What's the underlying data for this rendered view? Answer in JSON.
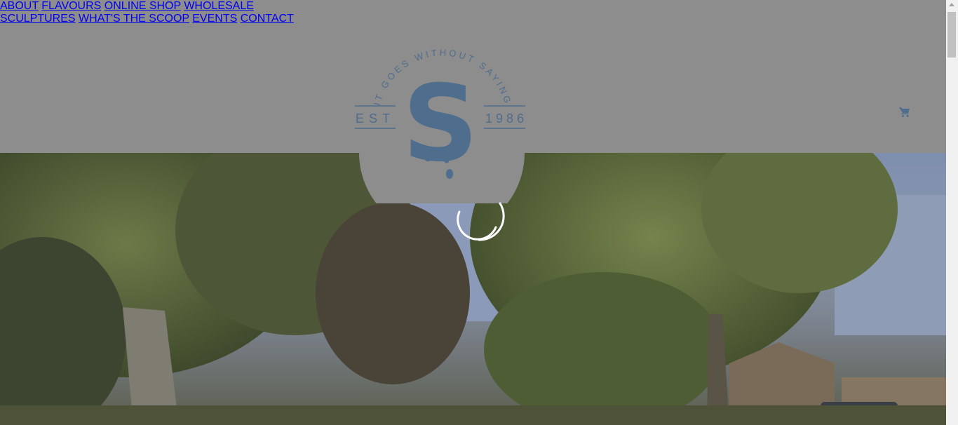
{
  "nav": {
    "left": [
      {
        "label": "ABOUT"
      },
      {
        "label": "FLAVOURS"
      },
      {
        "label": "ONLINE SHOP"
      },
      {
        "label": "WHOLESALE"
      }
    ],
    "right": [
      {
        "label": "SCULPTURES"
      },
      {
        "label": "WHAT'S THE SCOOP"
      },
      {
        "label": "EVENTS"
      },
      {
        "label": "CONTACT"
      }
    ],
    "cart_icon": "shopping-cart-icon"
  },
  "logo": {
    "tagline": "IT GOES WITHOUT SAYING",
    "est_label": "EST",
    "year": "1986",
    "letter": "S"
  },
  "colors": {
    "brand_blue": "#4f6d8c",
    "header_bg": "#8d8d8d"
  },
  "hero": {
    "state": "loading",
    "spinner_icon": "loading-spinner-icon"
  }
}
